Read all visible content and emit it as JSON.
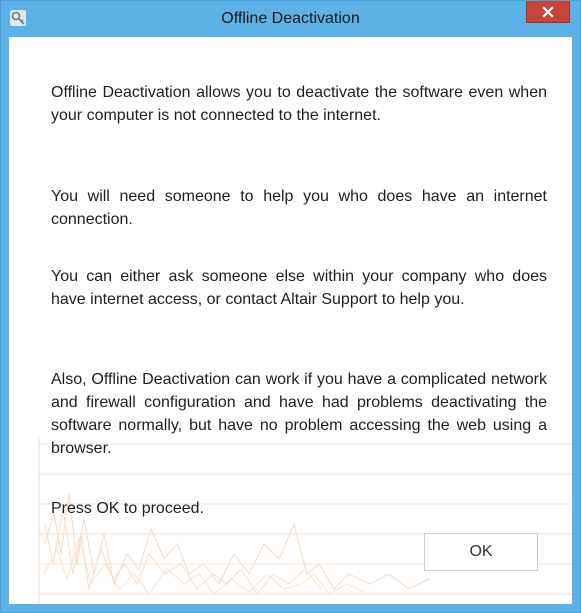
{
  "window": {
    "title": "Offline Deactivation",
    "accent_color": "#5cb1e6",
    "close_button_color": "#c7463a"
  },
  "message": {
    "paragraph_1": "Offline Deactivation allows you to deactivate the software even when your computer is not connected to the internet.",
    "paragraph_2": "You will need someone to help you who does have an internet connection.",
    "paragraph_3": "You can either ask someone else within your company who does have internet access, or contact Altair Support to help you.",
    "paragraph_4": "Also, Offline Deactivation can work if you have a complicated network and firewall configuration and have had problems deactivating the software normally, but have no problem accessing the web using a browser.",
    "paragraph_5": "Press OK to proceed."
  },
  "buttons": {
    "ok_label": "OK"
  },
  "icons": {
    "app_icon": "key-app-icon",
    "close_icon": "close-icon"
  }
}
